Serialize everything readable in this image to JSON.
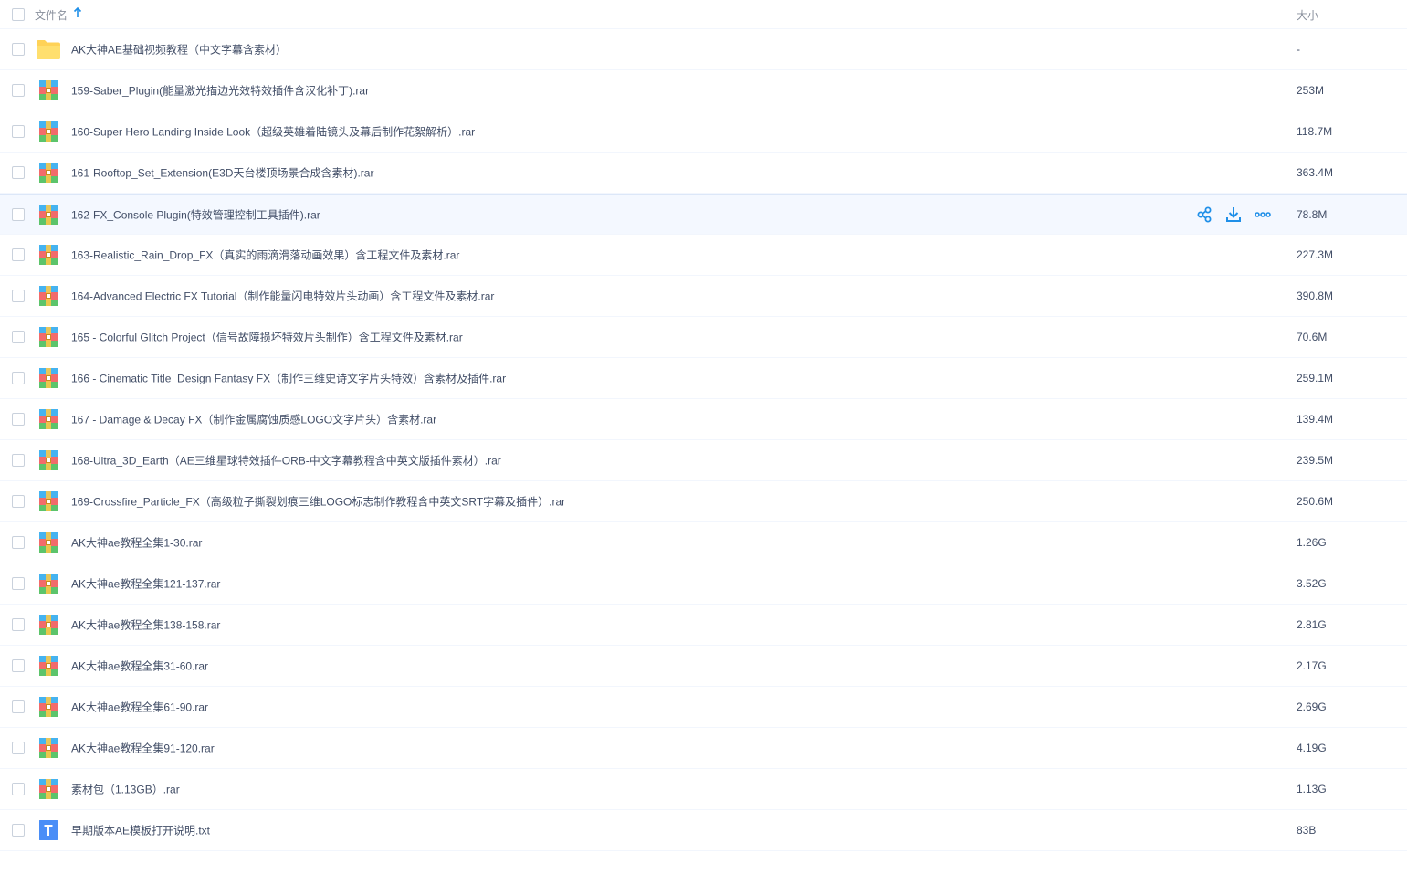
{
  "header": {
    "name_label": "文件名",
    "size_label": "大小",
    "sort_icon": "arrow-up-icon"
  },
  "colors": {
    "accent": "#1f8fe8",
    "text": "#424e67",
    "header_text": "#888f9c",
    "folder": "#ffd257",
    "hover_row": "#f4f8ff"
  },
  "row_actions": {
    "icons": [
      "share-icon",
      "download-icon",
      "more-icon"
    ]
  },
  "files": [
    {
      "name": "AK大神AE基础视频教程（中文字幕含素材）",
      "size": "-",
      "icon": "folder-icon"
    },
    {
      "name": "159-Saber_Plugin(能量激光描边光效特效插件含汉化补丁).rar",
      "size": "253M",
      "icon": "rar-icon"
    },
    {
      "name": "160-Super Hero Landing Inside Look（超级英雄着陆镜头及幕后制作花絮解析）.rar",
      "size": "118.7M",
      "icon": "rar-icon"
    },
    {
      "name": "161-Rooftop_Set_Extension(E3D天台楼顶场景合成含素材).rar",
      "size": "363.4M",
      "icon": "rar-icon"
    },
    {
      "name": "162-FX_Console Plugin(特效管理控制工具插件).rar",
      "size": "78.8M",
      "icon": "rar-icon",
      "hover": true
    },
    {
      "name": "163-Realistic_Rain_Drop_FX（真实的雨滴滑落动画效果）含工程文件及素材.rar",
      "size": "227.3M",
      "icon": "rar-icon"
    },
    {
      "name": "164-Advanced Electric FX Tutorial（制作能量闪电特效片头动画）含工程文件及素材.rar",
      "size": "390.8M",
      "icon": "rar-icon"
    },
    {
      "name": "165 - Colorful Glitch Project（信号故障损坏特效片头制作）含工程文件及素材.rar",
      "size": "70.6M",
      "icon": "rar-icon"
    },
    {
      "name": "166 - Cinematic Title_Design Fantasy FX（制作三维史诗文字片头特效）含素材及插件.rar",
      "size": "259.1M",
      "icon": "rar-icon"
    },
    {
      "name": "167 - Damage & Decay FX（制作金属腐蚀质感LOGO文字片头）含素材.rar",
      "size": "139.4M",
      "icon": "rar-icon"
    },
    {
      "name": "168-Ultra_3D_Earth（AE三维星球特效插件ORB-中文字幕教程含中英文版插件素材）.rar",
      "size": "239.5M",
      "icon": "rar-icon"
    },
    {
      "name": "169-Crossfire_Particle_FX（高级粒子撕裂划痕三维LOGO标志制作教程含中英文SRT字幕及插件）.rar",
      "size": "250.6M",
      "icon": "rar-icon"
    },
    {
      "name": "AK大神ae教程全集1-30.rar",
      "size": "1.26G",
      "icon": "rar-icon"
    },
    {
      "name": "AK大神ae教程全集121-137.rar",
      "size": "3.52G",
      "icon": "rar-icon"
    },
    {
      "name": "AK大神ae教程全集138-158.rar",
      "size": "2.81G",
      "icon": "rar-icon"
    },
    {
      "name": "AK大神ae教程全集31-60.rar",
      "size": "2.17G",
      "icon": "rar-icon"
    },
    {
      "name": "AK大神ae教程全集61-90.rar",
      "size": "2.69G",
      "icon": "rar-icon"
    },
    {
      "name": "AK大神ae教程全集91-120.rar",
      "size": "4.19G",
      "icon": "rar-icon"
    },
    {
      "name": "素材包（1.13GB）.rar",
      "size": "1.13G",
      "icon": "rar-icon"
    },
    {
      "name": "早期版本AE模板打开说明.txt",
      "size": "83B",
      "icon": "txt-icon"
    }
  ]
}
